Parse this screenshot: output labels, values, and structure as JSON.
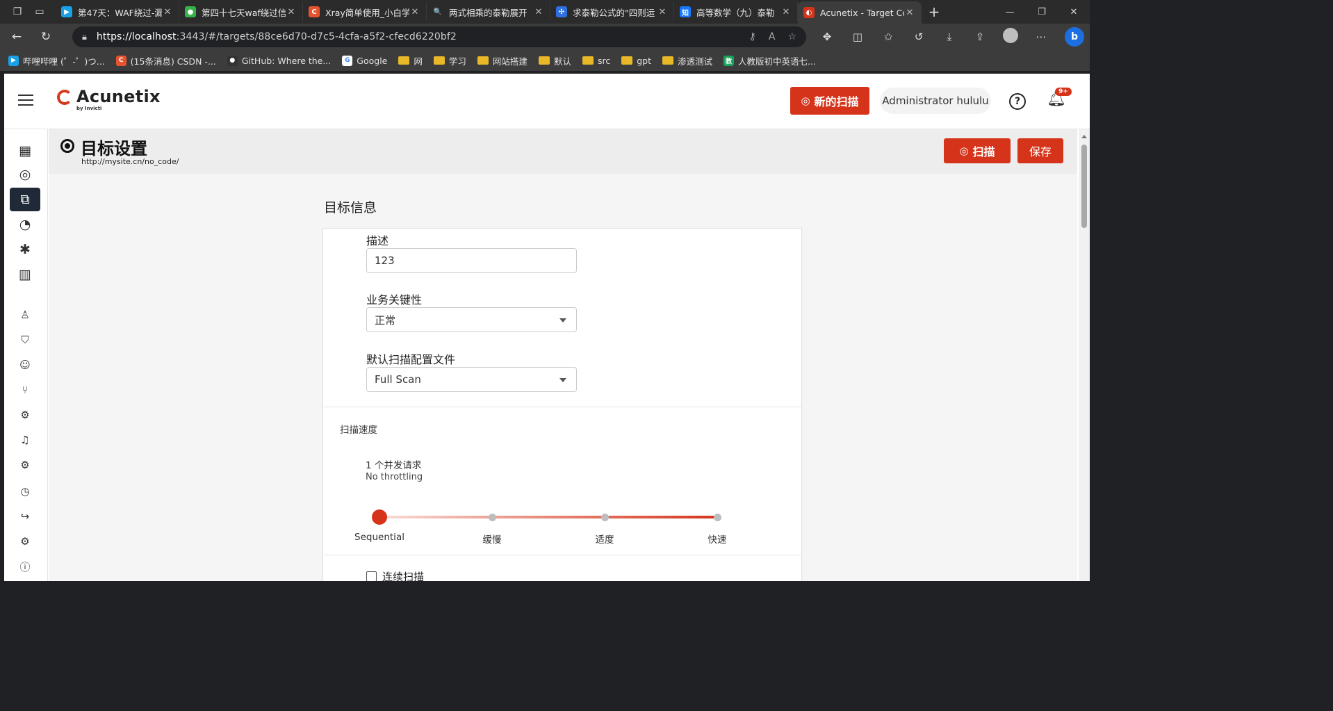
{
  "browser": {
    "tabs": [
      {
        "title": "第47天：WAF绕过-漏",
        "fav_color": "#1aa0e6",
        "fav_glyph": "▶"
      },
      {
        "title": "第四十七天waf绕过信",
        "fav_color": "#35b24a",
        "fav_glyph": "●"
      },
      {
        "title": "Xray简单使用_小白学",
        "fav_color": "#e8532f",
        "fav_glyph": "C"
      },
      {
        "title": "两式相乘的泰勒展开",
        "fav_color": "#2b2b2b",
        "fav_glyph": "🔍"
      },
      {
        "title": "求泰勒公式的\"四则运",
        "fav_color": "#2f6fe0",
        "fav_glyph": "✣"
      },
      {
        "title": "高等数学（九）泰勒",
        "fav_color": "#1677ff",
        "fav_glyph": "知"
      },
      {
        "title": "Acunetix - Target Cor",
        "fav_color": "#d6341a",
        "fav_glyph": "◐"
      }
    ],
    "url_host": "https://localhost",
    "url_rest": ":3443/#/targets/88ce6d70-d7c5-4cfa-a5f2-cfecd6220bf2",
    "bookmarks": [
      {
        "label": "哔哩哔哩 (゜-゜)つ...",
        "type": "icon",
        "color": "#1aa0e6",
        "glyph": "▶"
      },
      {
        "label": "(15条消息) CSDN -...",
        "type": "icon",
        "color": "#e8532f",
        "glyph": "C"
      },
      {
        "label": "GitHub: Where the...",
        "type": "icon",
        "color": "#333333",
        "glyph": "●"
      },
      {
        "label": "Google",
        "type": "icon",
        "color": "#ffffff",
        "glyph": "G"
      },
      {
        "label": "网",
        "type": "folder"
      },
      {
        "label": "学习",
        "type": "folder"
      },
      {
        "label": "网站搭建",
        "type": "folder"
      },
      {
        "label": "默认",
        "type": "folder"
      },
      {
        "label": "src",
        "type": "folder"
      },
      {
        "label": "gpt",
        "type": "folder"
      },
      {
        "label": "渗透测试",
        "type": "folder"
      },
      {
        "label": "人教版初中英语七...",
        "type": "icon",
        "color": "#19a35b",
        "glyph": "教"
      }
    ]
  },
  "app": {
    "logo_text": "Acunetix",
    "logo_sub": "by Invicti",
    "new_scan_label": "新的扫描",
    "user_name": "Administrator hululu",
    "notification_badge": "9+",
    "accent_color": "#d6341a"
  },
  "page": {
    "title": "目标设置",
    "target_url": "http://mysite.cn/no_code/",
    "scan_label": "扫描",
    "save_label": "保存",
    "section_title": "目标信息"
  },
  "form": {
    "description_label": "描述",
    "description_value": "123",
    "criticality_label": "业务关键性",
    "criticality_value": "正常",
    "profile_label": "默认扫描配置文件",
    "profile_value": "Full Scan",
    "speed_title": "扫描速度",
    "speed_requests": "1 个并发请求",
    "speed_throttle": "No throttling",
    "speed_levels": [
      "Sequential",
      "缓慢",
      "适度",
      "快速"
    ],
    "speed_selected_index": 0,
    "continuous_scan_label": "连续扫描"
  }
}
